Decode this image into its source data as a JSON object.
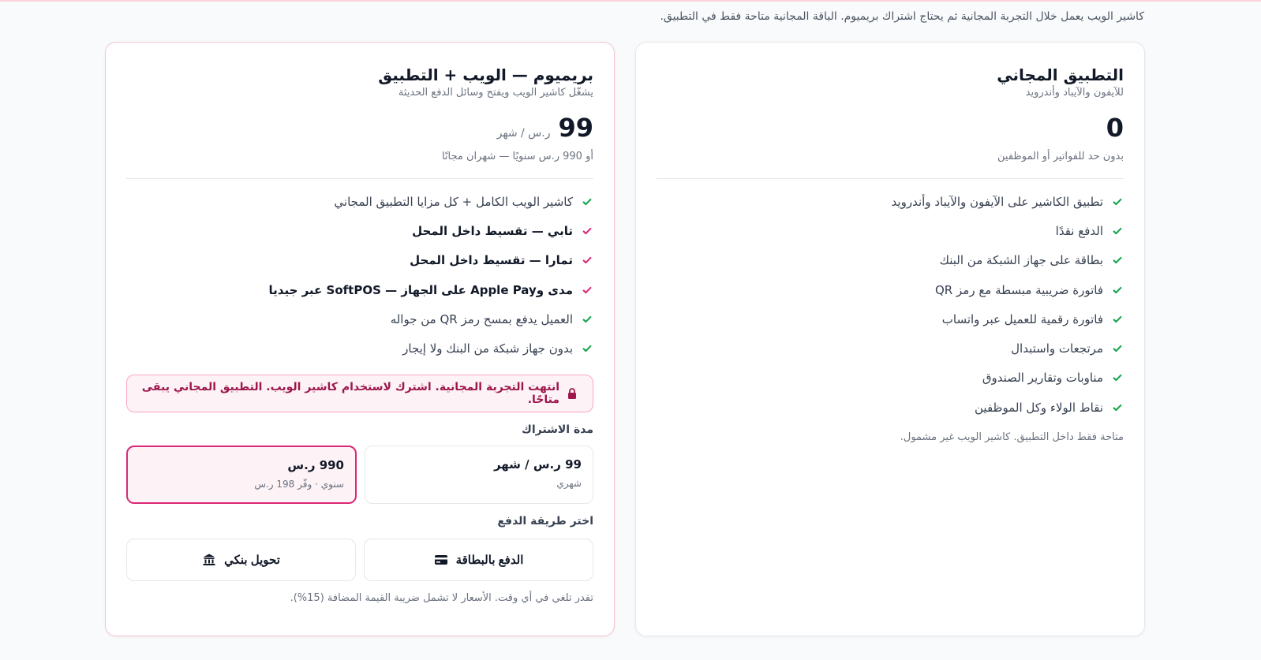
{
  "intro": "كاشير الويب يعمل خلال التجربة المجانية ثم يحتاج اشتراك بريميوم. الباقة المجانية متاحة فقط في التطبيق.",
  "colors": {
    "accent": "#db2777",
    "check_green": "#16a34a",
    "alert_bg": "#fdf2f5"
  },
  "free": {
    "title": "التطبيق المجاني",
    "subtitle": "للآيفون والآيباد وأندرويد",
    "price": "0",
    "note": "بدون حد للفواتير أو الموظفين",
    "features": [
      "تطبيق الكاشير على الآيفون والآيباد وأندرويد",
      "الدفع نقدًا",
      "بطاقة على جهاز الشبكة من البنك",
      "فاتورة ضريبية مبسطة مع رمز QR",
      "فاتورة رقمية للعميل عبر واتساب",
      "مرتجعات واستبدال",
      "مناوبات وتقارير الصندوق",
      "نقاط الولاء وكل الموظفين"
    ],
    "footnote": "متاحة فقط داخل التطبيق. كاشير الويب غير مشمول."
  },
  "premium": {
    "title": "بريميوم — الويب + التطبيق",
    "subtitle": "يشغّل كاشير الويب ويفتح وسائل الدفع الحديثة",
    "price": "99",
    "price_unit": "ر.س / شهر",
    "note": "أو 990 ر.س سنويًا — شهران مجانًا",
    "features": [
      "كاشير الويب الكامل + كل مزايا التطبيق المجاني",
      "تابي — تقسيط داخل المحل",
      "تمارا — تقسيط داخل المحل",
      "مدى وApple Pay على الجهاز — SoftPOS عبر جيديا",
      "العميل يدفع بمسح رمز QR من جواله",
      "بدون جهاز شبكة من البنك ولا إيجار"
    ],
    "alert": "انتهت التجربة المجانية. اشترك لاستخدام كاشير الويب. التطبيق المجاني يبقى متاحًا.",
    "duration_label": "مدة الاشتراك",
    "monthly": {
      "title": "99 ر.س / شهر",
      "sub": "شهري"
    },
    "yearly": {
      "title": "990 ر.س",
      "sub": "سنوي · وفّر 198 ر.س",
      "selected": true
    },
    "payment_label": "اختر طريقة الدفع",
    "pay_card": "الدفع بالبطاقة",
    "pay_bank": "تحويل بنكي",
    "footnote": "تقدر تلغي في أي وقت. الأسعار لا تشمل ضريبة القيمة المضافة (15%)."
  }
}
